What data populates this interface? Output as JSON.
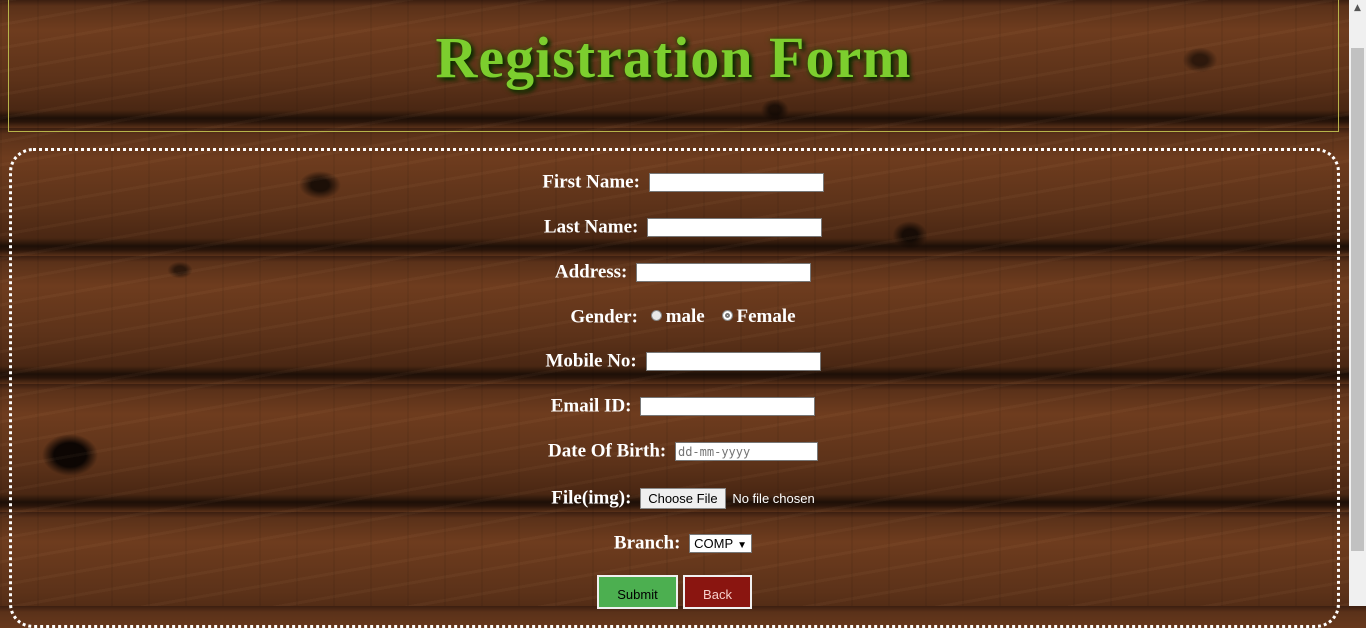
{
  "header": {
    "title": "Registration Form"
  },
  "form": {
    "first_name": {
      "label": "First Name:",
      "value": ""
    },
    "last_name": {
      "label": "Last Name:",
      "value": ""
    },
    "address": {
      "label": "Address:",
      "value": ""
    },
    "gender": {
      "label": "Gender:",
      "options": [
        "male",
        "Female"
      ],
      "selected": "Female"
    },
    "mobile": {
      "label": "Mobile No:",
      "value": ""
    },
    "email": {
      "label": "Email ID:",
      "value": ""
    },
    "dob": {
      "label": "Date Of Birth:",
      "placeholder": "dd-mm-yyyy"
    },
    "file": {
      "label": "File(img):",
      "button": "Choose File",
      "status": "No file chosen"
    },
    "branch": {
      "label": "Branch:",
      "selected": "COMP"
    },
    "submit_label": "Submit",
    "back_label": "Back"
  },
  "colors": {
    "title": "#7cce2e",
    "submit": "#4caf50",
    "back": "#8a1510"
  }
}
